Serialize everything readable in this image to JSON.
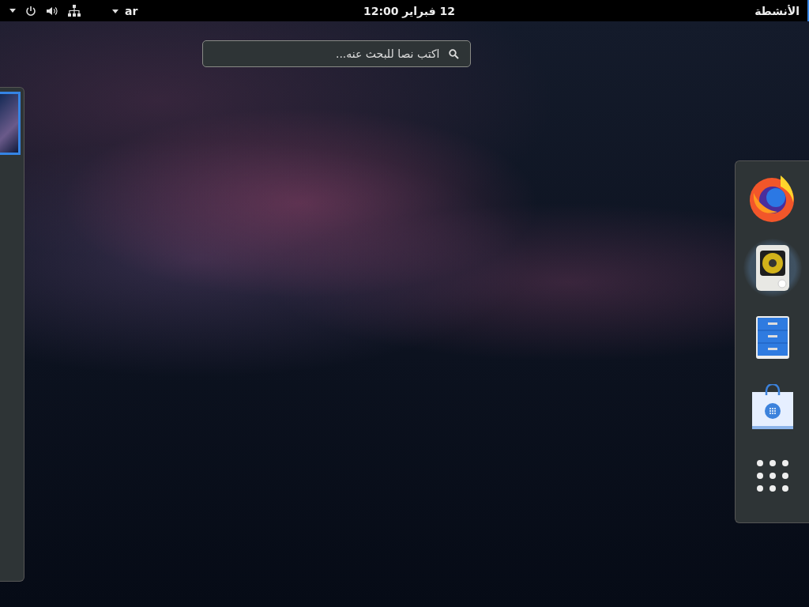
{
  "top_bar": {
    "activities": {
      "label": "الأنشطة",
      "selected": true
    },
    "clock": "12 فبراير 12:00",
    "keyboard_layout": "ar"
  },
  "search": {
    "placeholder": "اكتب نصا للبحث عنه..."
  },
  "workspaces": [
    {
      "selected": true
    }
  ],
  "dock": [
    {
      "running": false
    },
    {
      "running": true
    },
    {
      "running": false
    },
    {
      "running": false
    }
  ]
}
